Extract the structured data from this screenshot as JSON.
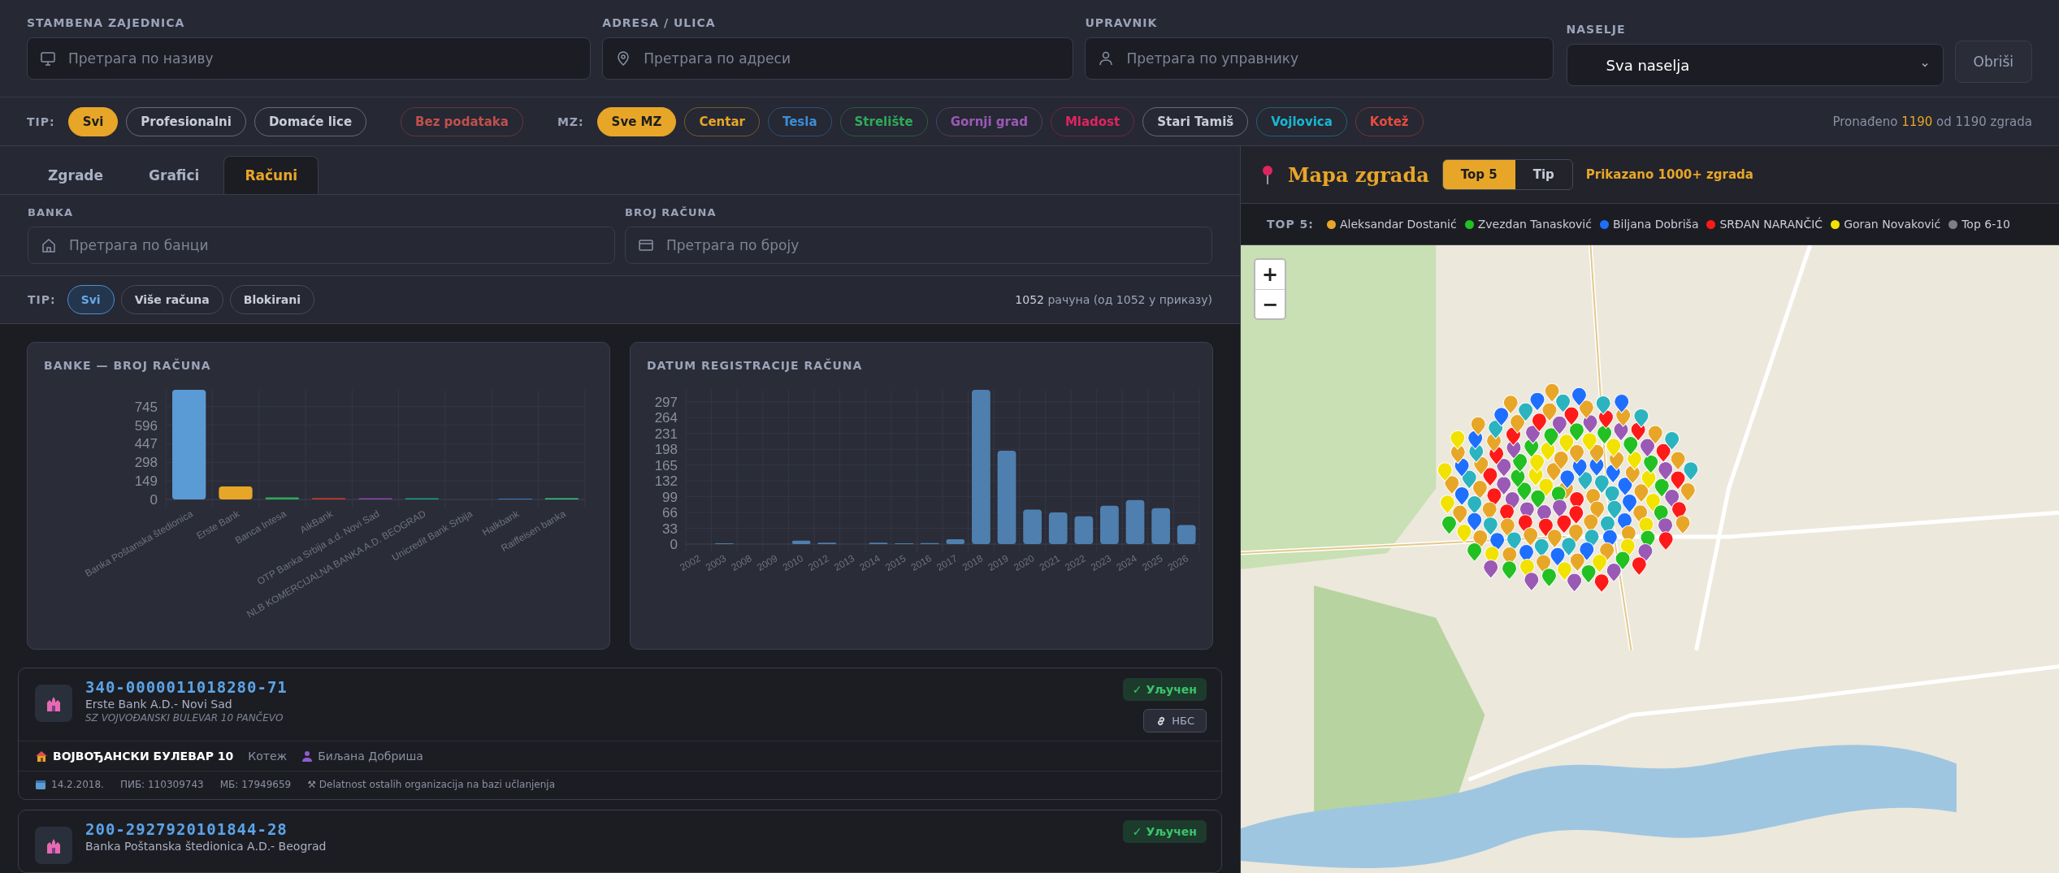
{
  "filters": {
    "fields": [
      {
        "label": "STAMBENA ZAJEDNICA",
        "placeholder": "Претрага по називу",
        "kind": "monitor"
      },
      {
        "label": "ADRESA / ULICA",
        "placeholder": "Претрага по адреси",
        "kind": "pin"
      },
      {
        "label": "UPRAVNIK",
        "placeholder": "Претрага по управнику",
        "kind": "person"
      }
    ],
    "settlement": {
      "label": "NASELJE",
      "value": "Sva naselja"
    },
    "clear_button": "Obriši"
  },
  "type_filter": {
    "label": "TIP:",
    "options": [
      {
        "label": "Svi",
        "selected": true,
        "color": "#e8a628"
      },
      {
        "label": "Profesionalni",
        "selected": false,
        "color": "#c9cdd8"
      },
      {
        "label": "Domaće lice",
        "selected": false,
        "color": "#c9cdd8"
      },
      {
        "label": "Bez podataka",
        "selected": false,
        "color": "#c0504d"
      }
    ]
  },
  "mz_filter": {
    "label": "MZ:",
    "options": [
      {
        "label": "Sve MZ",
        "selected": true,
        "color": "#e8a628"
      },
      {
        "label": "Centar",
        "selected": false,
        "color": "#e8a628"
      },
      {
        "label": "Tesla",
        "selected": false,
        "color": "#3a8fd8"
      },
      {
        "label": "Strelište",
        "selected": false,
        "color": "#2eaa5a"
      },
      {
        "label": "Gornji grad",
        "selected": false,
        "color": "#9b59b6"
      },
      {
        "label": "Mladost",
        "selected": false,
        "color": "#e0245e"
      },
      {
        "label": "Stari Tamiš",
        "selected": false,
        "color": "#c9cdd8"
      },
      {
        "label": "Vojlovica",
        "selected": false,
        "color": "#17b8d0"
      },
      {
        "label": "Kotež",
        "selected": false,
        "color": "#e74c3c"
      }
    ]
  },
  "result_count": {
    "prefix": "Pronađeno",
    "found": "1190",
    "suffix": "od 1190 zgrada"
  },
  "tabs": [
    {
      "label": "Zgrade",
      "selected": false
    },
    {
      "label": "Grafici",
      "selected": false
    },
    {
      "label": "Računi",
      "selected": true
    }
  ],
  "account_filters": [
    {
      "label": "BANKA",
      "placeholder": "Претрага по банци",
      "kind": "bank"
    },
    {
      "label": "BROJ RAČUNA",
      "placeholder": "Претрага по броју",
      "kind": "card"
    }
  ],
  "account_type": {
    "label": "TIP:",
    "options": [
      {
        "label": "Svi",
        "selected": true
      },
      {
        "label": "Više računa",
        "selected": false
      },
      {
        "label": "Blokirani",
        "selected": false
      }
    ]
  },
  "account_count": {
    "count": "1052",
    "rest": "рачуна (од 1052 у приказу)"
  },
  "charts": [
    {
      "title": "BANKE — BROJ RAČUNA",
      "chart_data": {
        "type": "bar",
        "categories": [
          "Banka Poštanska štedionica",
          "Erste Bank",
          "Banca Intesa",
          "AikBank",
          "OTP Banka Srbija a.d. Novi Sad",
          "NLB KOMERCIJALNA BANKA A.D. BEOGRAD",
          "Unicredit Bank Srbija",
          "Halkbank",
          "Raiffeisen banka"
        ],
        "series": [
          {
            "values": [
              880,
              104,
              16,
              12,
              9,
              9,
              0,
              6,
              9
            ]
          }
        ],
        "colors": [
          "#5b9bd5",
          "#e8a628",
          "#2eaa5a",
          "#c0392b",
          "#8e44ad",
          "#16a085",
          null,
          "#3a7dc0",
          "#2ecc71"
        ],
        "grid": true,
        "ylim": [
          0,
          880
        ],
        "yticks": [
          0,
          149,
          298,
          447,
          596,
          745
        ]
      }
    },
    {
      "title": "DATUM REGISTRACIJE RAČUNA",
      "chart_data": {
        "type": "bar",
        "categories": [
          "2002",
          "2003",
          "2008",
          "2009",
          "2010",
          "2012",
          "2013",
          "2014",
          "2015",
          "2016",
          "2017",
          "2018",
          "2019",
          "2020",
          "2021",
          "2022",
          "2023",
          "2024",
          "2025",
          "2026"
        ],
        "grid": true,
        "series": [
          {
            "color": "#4e7fae",
            "values": [
              0,
              1,
              0,
              0,
              7,
              3,
              0,
              3,
              1,
              2,
              10,
              322,
              195,
              72,
              66,
              58,
              80,
              92,
              75,
              40
            ]
          }
        ],
        "ylim": [
          0,
          322
        ],
        "yticks": [
          0,
          33,
          66,
          99,
          132,
          165,
          198,
          231,
          264,
          297
        ]
      }
    }
  ],
  "accounts": [
    {
      "number": "340-0000011018280-71",
      "bank": "Erste Bank A.D.- Novi Sad",
      "community": "SZ VOJVOĐANSKI BULEVAR 10 PANČEVO",
      "status": "✓ Уључен",
      "link": "НБС",
      "building": "ВОЈВОЂАНСКИ БУЛЕВАР 10",
      "area": "Котеж",
      "manager": "Биљана Добриша",
      "date": "14.2.2018.",
      "pib": "ПИБ: 110309743",
      "mb": "МБ: 17949659",
      "activity": "⚒ Delatnost ostalih organizacija na bazi učlanjenja"
    },
    {
      "number": "200-2927920101844-28",
      "bank": "Banka Poštanska štedionica A.D.- Beograd",
      "status": "✓ Уључен"
    }
  ],
  "map": {
    "title": "Mapa zgrada",
    "modes": [
      {
        "label": "Top 5",
        "selected": true
      },
      {
        "label": "Tip",
        "selected": false
      }
    ],
    "notice": "Prikazano 1000+ zgrada",
    "legend_label": "TOP 5:",
    "legend": [
      {
        "label": "Aleksandar Dostanić",
        "color": "#e8a628"
      },
      {
        "label": "Zvezdan Tanasković",
        "color": "#22c022"
      },
      {
        "label": "Biljana Dobriša",
        "color": "#1f6fff"
      },
      {
        "label": "SRĐAN NARANČIĆ",
        "color": "#ff1a1a"
      },
      {
        "label": "Goran Novaković",
        "color": "#f2e200"
      },
      {
        "label": "Top 6-10",
        "color": "#7a7f8a"
      }
    ],
    "zoom_in": "+",
    "zoom_out": "−"
  }
}
